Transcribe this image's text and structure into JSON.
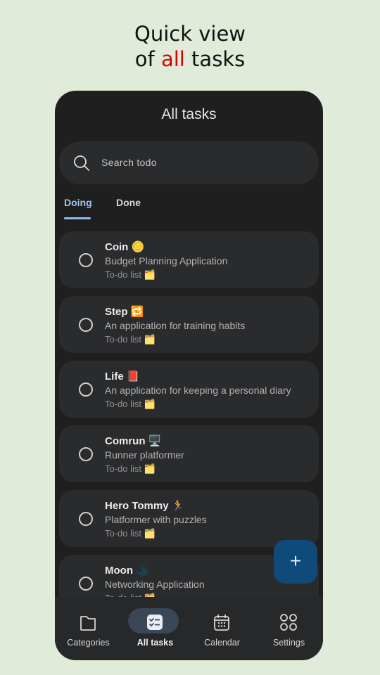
{
  "headline": {
    "line1": "Quick view",
    "line2_pre": "of ",
    "line2_accent": "all",
    "line2_post": " tasks"
  },
  "header": {
    "title": "All tasks"
  },
  "search": {
    "placeholder": "Search todo",
    "icon": "search-icon"
  },
  "tabs": [
    {
      "label": "Doing",
      "selected": true
    },
    {
      "label": "Done",
      "selected": false
    }
  ],
  "tasks": [
    {
      "name": "Coin 🪙",
      "description": "Budget Planning Application",
      "list": "To-do list 🗂️"
    },
    {
      "name": "Step 🔁",
      "description": "An application for training habits",
      "list": "To-do list 🗂️"
    },
    {
      "name": "Life 📕",
      "description": "An application for keeping a personal diary",
      "list": "To-do list 🗂️"
    },
    {
      "name": "Comrun 🖥️",
      "description": "Runner platformer",
      "list": "To-do list 🗂️"
    },
    {
      "name": "Hero Tommy 🏃",
      "description": "Platformer with puzzles",
      "list": "To-do list 🗂️"
    },
    {
      "name": "Moon 🌑",
      "description": "Networking Application",
      "list": "To-do list 🗂️"
    }
  ],
  "fab": {
    "label": "+",
    "icon": "plus-icon"
  },
  "nav": [
    {
      "label": "Categories",
      "icon": "folder-icon",
      "active": false
    },
    {
      "label": "All tasks",
      "icon": "checklist-icon",
      "active": true
    },
    {
      "label": "Calendar",
      "icon": "calendar-icon",
      "active": false
    },
    {
      "label": "Settings",
      "icon": "grid-icon",
      "active": false
    }
  ],
  "colors": {
    "background": "#e1ebd9",
    "surface": "#1f1f20",
    "card": "#2a2b2d",
    "accent": "#8fbcec",
    "fab": "#104a7a",
    "headline_accent": "#e00000"
  }
}
